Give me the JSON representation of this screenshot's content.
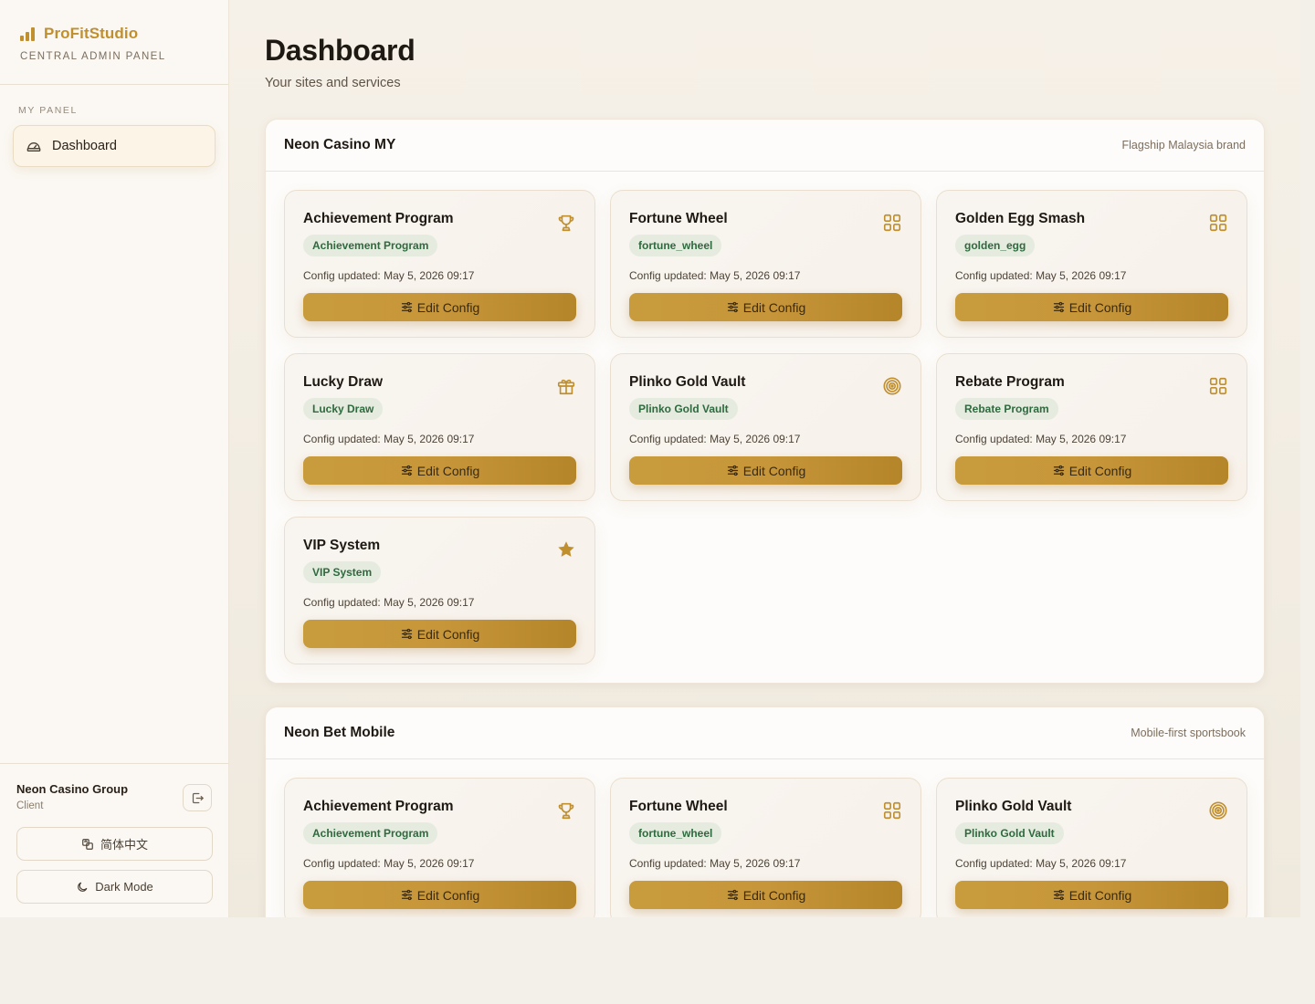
{
  "brand": {
    "name": "ProFitStudio",
    "subtitle": "CENTRAL ADMIN PANEL"
  },
  "nav": {
    "section": "MY PANEL",
    "items": [
      {
        "label": "Dashboard",
        "icon": "dashboard-gauge-icon"
      }
    ]
  },
  "footer": {
    "user_name": "Neon Casino Group",
    "user_role": "Client",
    "language_label": "简体中文",
    "dark_mode_label": "Dark Mode"
  },
  "page": {
    "title": "Dashboard",
    "subtitle": "Your sites and services"
  },
  "colors": {
    "accent": "#c08f2e",
    "badge_bg": "#e5ebdf",
    "badge_text": "#2e6a3e"
  },
  "sites": [
    {
      "name": "Neon Casino MY",
      "description": "Flagship Malaysia brand",
      "services": [
        {
          "title": "Achievement Program",
          "badge": "Achievement Program",
          "icon": "trophy-icon",
          "updated": "Config updated: May 5, 2026 09:17",
          "button": "Edit Config"
        },
        {
          "title": "Fortune Wheel",
          "badge": "fortune_wheel",
          "icon": "grid-icon",
          "updated": "Config updated: May 5, 2026 09:17",
          "button": "Edit Config"
        },
        {
          "title": "Golden Egg Smash",
          "badge": "golden_egg",
          "icon": "grid-icon",
          "updated": "Config updated: May 5, 2026 09:17",
          "button": "Edit Config"
        },
        {
          "title": "Lucky Draw",
          "badge": "Lucky Draw",
          "icon": "gift-icon",
          "updated": "Config updated: May 5, 2026 09:17",
          "button": "Edit Config"
        },
        {
          "title": "Plinko Gold Vault",
          "badge": "Plinko Gold Vault",
          "icon": "target-icon",
          "updated": "Config updated: May 5, 2026 09:17",
          "button": "Edit Config"
        },
        {
          "title": "Rebate Program",
          "badge": "Rebate Program",
          "icon": "grid-icon",
          "updated": "Config updated: May 5, 2026 09:17",
          "button": "Edit Config"
        },
        {
          "title": "VIP System",
          "badge": "VIP System",
          "icon": "star-icon",
          "updated": "Config updated: May 5, 2026 09:17",
          "button": "Edit Config"
        }
      ]
    },
    {
      "name": "Neon Bet Mobile",
      "description": "Mobile-first sportsbook",
      "services": [
        {
          "title": "Achievement Program",
          "badge": "Achievement Program",
          "icon": "trophy-icon",
          "updated": "Config updated: May 5, 2026 09:17",
          "button": "Edit Config"
        },
        {
          "title": "Fortune Wheel",
          "badge": "fortune_wheel",
          "icon": "grid-icon",
          "updated": "Config updated: May 5, 2026 09:17",
          "button": "Edit Config"
        },
        {
          "title": "Plinko Gold Vault",
          "badge": "Plinko Gold Vault",
          "icon": "target-icon",
          "updated": "Config updated: May 5, 2026 09:17",
          "button": "Edit Config"
        }
      ]
    }
  ]
}
